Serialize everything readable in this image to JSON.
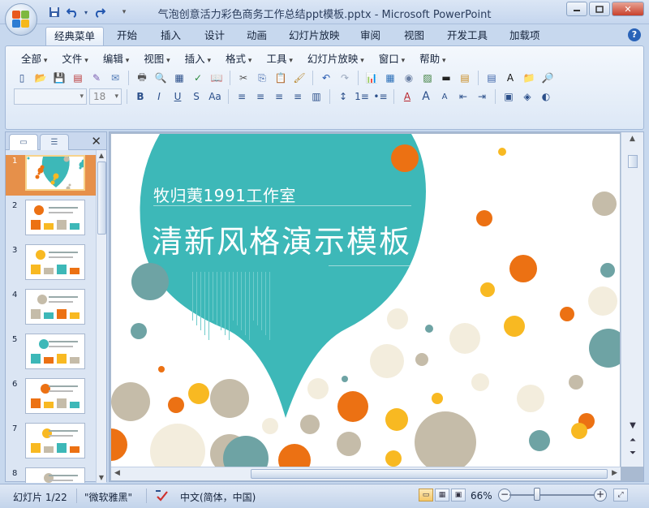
{
  "window": {
    "title": "气泡创意活力彩色商务工作总结ppt模板.pptx - Microsoft PowerPoint",
    "controls": {
      "minimize": "▭",
      "maximize": "▢",
      "close": "✕"
    }
  },
  "quick_access": [
    {
      "name": "save-icon",
      "glyph": "💾"
    },
    {
      "name": "undo-icon",
      "glyph": "↶"
    },
    {
      "name": "redo-icon",
      "glyph": "↷"
    },
    {
      "name": "customize-icon",
      "glyph": "▾"
    }
  ],
  "ribbon_tabs": [
    "经典菜单",
    "开始",
    "插入",
    "设计",
    "动画",
    "幻灯片放映",
    "审阅",
    "视图",
    "开发工具",
    "加载项"
  ],
  "active_tab": "经典菜单",
  "help_label": "?",
  "menus": [
    "全部",
    "文件",
    "编辑",
    "视图",
    "插入",
    "格式",
    "工具",
    "幻灯片放映",
    "窗口",
    "帮助"
  ],
  "toolbar": {
    "font_name": "",
    "font_size": "18",
    "row1_icons": [
      "new-icon",
      "open-icon",
      "save-icon",
      "pdf-icon",
      "permission-icon",
      "email-icon",
      "print-icon",
      "print-preview-icon",
      "layout-icon",
      "spelling-icon",
      "research-icon",
      "cut-icon",
      "copy-icon",
      "paste-icon",
      "format-painter-icon",
      "undo-icon",
      "redo-icon",
      "chart-icon",
      "table-icon",
      "clipart-icon",
      "picture-icon",
      "shape-icon",
      "new-slide-icon",
      "layout-slide-icon",
      "textbox-icon",
      "folder-icon",
      "find-icon"
    ],
    "row2_icons": [
      "bold-icon",
      "italic-icon",
      "underline-icon",
      "strikethrough-icon",
      "case-icon",
      "align-left-icon",
      "align-center-icon",
      "align-right-icon",
      "justify-icon",
      "columns-icon",
      "line-spacing-icon",
      "numbering-icon",
      "bullets-icon",
      "font-color-icon",
      "grow-font-icon",
      "shrink-font-icon",
      "decrease-indent-icon",
      "increase-indent-icon",
      "arrange-icon",
      "quick-styles-icon",
      "shape-fill-icon"
    ],
    "row2_glyphs": [
      "B",
      "I",
      "U",
      "S",
      "Aa",
      "≡",
      "≡",
      "≡",
      "≡",
      "▥",
      "↕",
      "1≡",
      "•≡",
      "A",
      "A",
      "A",
      "⇤",
      "⇥",
      "▣",
      "◈",
      "◐"
    ]
  },
  "slides_pane": {
    "tab_slides": "▭",
    "tab_outline": "☰",
    "close": "✕",
    "slide_numbers": [
      "1",
      "2",
      "3",
      "4",
      "5",
      "6",
      "7",
      "8"
    ],
    "selected": "1"
  },
  "slide": {
    "subtitle": "牧归荑1991工作室",
    "title": "清新风格演示模板",
    "colors": {
      "teal": "#3db8b8",
      "orange": "#ec7113",
      "yellow": "#f8b922",
      "beige": "#f3eddd",
      "taupe": "#c5bca9",
      "dark_teal": "#6ea3a4"
    }
  },
  "status": {
    "slide_indicator": "幻灯片 1/22",
    "theme": "\"微软雅黑\"",
    "language": "中文(简体，中国)",
    "zoom": "66%",
    "zoom_minus": "−",
    "zoom_plus": "+"
  }
}
